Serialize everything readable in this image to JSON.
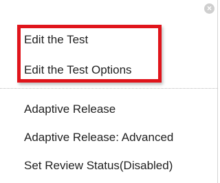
{
  "menu": {
    "close_icon": "×",
    "items": [
      {
        "label": "Edit the Test"
      },
      {
        "label": "Edit the Test Options"
      },
      {
        "label": "Adaptive Release"
      },
      {
        "label": "Adaptive Release: Advanced"
      },
      {
        "label": "Set Review Status(Disabled)"
      }
    ]
  },
  "colors": {
    "highlight_border": "#e0141b",
    "text": "#1f1f1f"
  }
}
